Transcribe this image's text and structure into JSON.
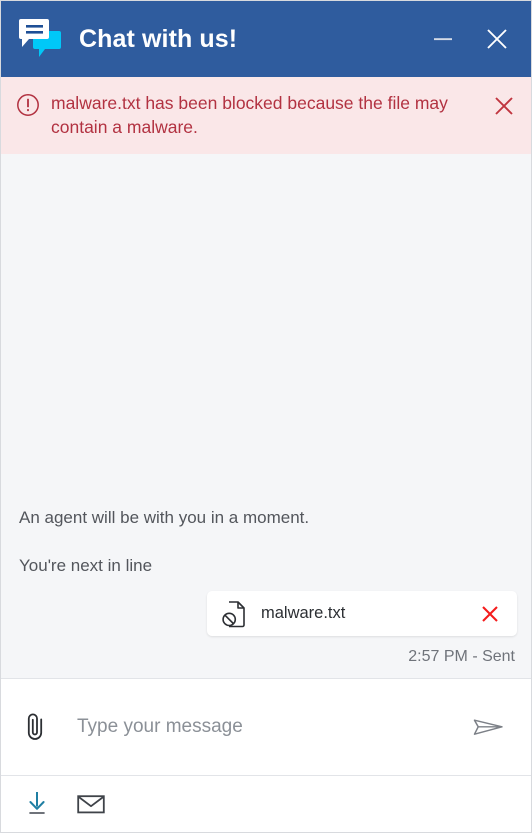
{
  "window": {
    "title": "Chat with us!",
    "brand_icon": "chat-bubbles-icon",
    "minimize_label": "Minimize",
    "close_label": "Close"
  },
  "alert": {
    "icon": "exclamation-circle-icon",
    "message": "malware.txt has been blocked because the file may contain a malware.",
    "close_label": "Dismiss alert",
    "text_color": "#b23241",
    "background_color": "#fae7e8"
  },
  "conversation": {
    "messages": [
      {
        "text": "An agent will be with you in a moment."
      },
      {
        "text": "You're next in line"
      }
    ],
    "attachment": {
      "icon": "blocked-file-icon",
      "filename": "malware.txt",
      "remove_label": "Remove attachment",
      "remove_icon": "close-icon",
      "remove_color": "#f41c1c"
    },
    "status": "2:57 PM - Sent"
  },
  "composer": {
    "attach_icon": "paperclip-icon",
    "attach_label": "Attach file",
    "input_value": "",
    "placeholder": "Type your message",
    "send_icon": "send-paper-plane-icon",
    "send_label": "Send message"
  },
  "footer": {
    "tools": [
      {
        "icon": "download-icon",
        "label": "Download transcript",
        "color": "#1f7fa3"
      },
      {
        "icon": "envelope-icon",
        "label": "Email transcript",
        "color": "#3f4349"
      }
    ]
  },
  "theme": {
    "header_background": "#2f5c9e",
    "panel_background": "#f5f6f8",
    "accent": "#00c4f0"
  }
}
